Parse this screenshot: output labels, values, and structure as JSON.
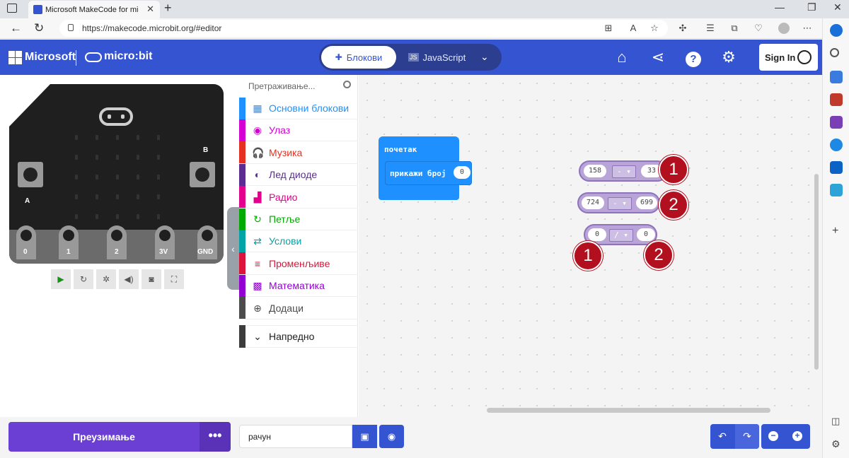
{
  "browser": {
    "tab_title": "Microsoft MakeCode for micro:bit",
    "url": "https://makecode.microbit.org/#editor",
    "new_tab": "+"
  },
  "header": {
    "microsoft": "Microsoft",
    "microbit": "micro:bit",
    "editor_tabs": {
      "blocks": "Блокови",
      "javascript": "JavaScript"
    },
    "sign_in": "Sign In",
    "brand_color": "#3454d1"
  },
  "simulator": {
    "button_a": "A",
    "button_b": "B",
    "pins": [
      "0",
      "1",
      "2",
      "3V",
      "GND"
    ],
    "tools": [
      "play-icon",
      "restart-icon",
      "debug-icon",
      "sound-icon",
      "screenshot-icon",
      "fullscreen-icon"
    ]
  },
  "toolbox": {
    "search_placeholder": "Претраживање...",
    "categories": [
      {
        "label": "Основни блокови",
        "color": "#1e90ff",
        "icon": "grid-icon"
      },
      {
        "label": "Улаз",
        "color": "#d400d4",
        "icon": "input-icon"
      },
      {
        "label": "Музика",
        "color": "#e63022",
        "icon": "headphones-icon"
      },
      {
        "label": "Лед диоде",
        "color": "#5c2d91",
        "icon": "toggle-icon"
      },
      {
        "label": "Радио",
        "color": "#e3008c",
        "icon": "signal-icon"
      },
      {
        "label": "Петље",
        "color": "#00aa00",
        "icon": "loop-icon"
      },
      {
        "label": "Услови",
        "color": "#00a4a6",
        "icon": "shuffle-icon"
      },
      {
        "label": "Променљиве",
        "color": "#dc143c",
        "icon": "lines-icon"
      },
      {
        "label": "Математика",
        "color": "#9400d3",
        "icon": "calculator-icon"
      },
      {
        "label": "Додаци",
        "color": "#4c4c4c",
        "icon": "plus-circle-icon"
      }
    ],
    "advanced": "Напредно"
  },
  "workspace": {
    "on_start": "почетак",
    "show_number": "прикажи број",
    "show_number_value": "0",
    "math_blocks": [
      {
        "left": "158",
        "op": "- ▾",
        "right": "33"
      },
      {
        "left": "724",
        "op": "- ▾",
        "right": "699"
      },
      {
        "left": "0",
        "op": "/ ▾",
        "right": "0"
      }
    ],
    "badges": [
      "1",
      "2",
      "1",
      "2"
    ]
  },
  "bottom": {
    "download": "Преузимање",
    "more": "•••",
    "project_name": "рачун"
  }
}
